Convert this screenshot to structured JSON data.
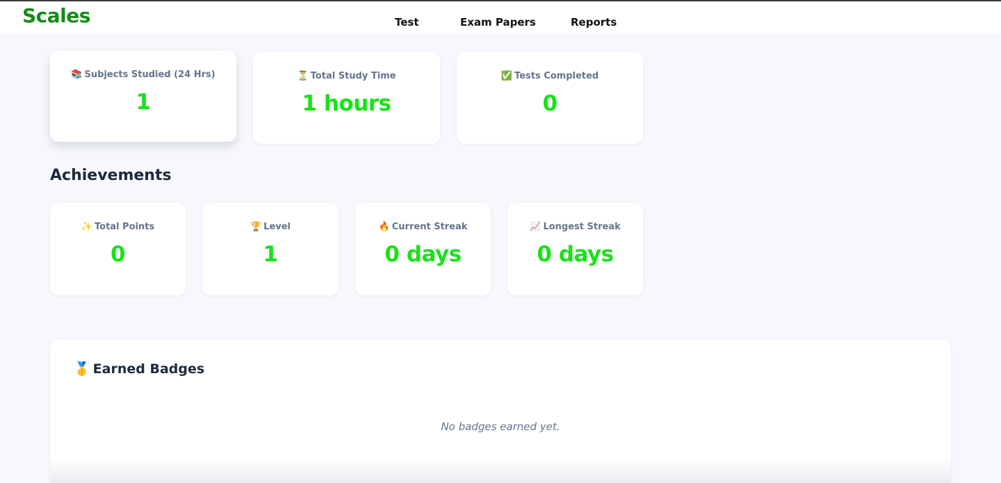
{
  "app": {
    "logo": "Scales"
  },
  "nav": {
    "items": [
      "Test",
      "Exam Papers",
      "Reports"
    ]
  },
  "stats": [
    {
      "emoji": "📚",
      "label": "Subjects Studied (24 Hrs)",
      "value": "1"
    },
    {
      "emoji": "⏳",
      "label": "Total Study Time",
      "value": "1 hours"
    },
    {
      "emoji": "✅",
      "label": "Tests Completed",
      "value": "0"
    }
  ],
  "achievements": {
    "title": "Achievements",
    "items": [
      {
        "emoji": "✨",
        "label": "Total Points",
        "value": "0"
      },
      {
        "emoji": "🏆",
        "label": "Level",
        "value": "1"
      },
      {
        "emoji": "🔥",
        "label": "Current Streak",
        "value": "0 days"
      },
      {
        "emoji": "📈",
        "label": "Longest Streak",
        "value": "0 days"
      }
    ]
  },
  "badges": {
    "emoji": "🥇",
    "title": "Earned Badges",
    "empty_text": "No badges earned yet."
  },
  "colors": {
    "brand": "#178b17",
    "accent": "#17e317",
    "muted": "#64748b",
    "background": "#f6f8fd"
  }
}
